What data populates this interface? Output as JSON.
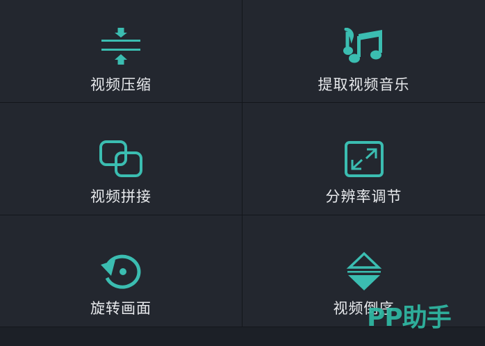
{
  "theme": {
    "accent": "#3bbdb1",
    "tile_background": "#23272f",
    "divider": "#13161b",
    "label_color": "#e8eaed"
  },
  "tools": [
    {
      "label": "视频压缩",
      "icon": "compress-icon"
    },
    {
      "label": "提取视频音乐",
      "icon": "music-note-icon"
    },
    {
      "label": "视频拼接",
      "icon": "overlap-squares-icon"
    },
    {
      "label": "分辨率调节",
      "icon": "expand-arrows-icon"
    },
    {
      "label": "旋转画面",
      "icon": "rotate-icon"
    },
    {
      "label": "视频倒序",
      "icon": "reverse-triangles-icon"
    }
  ],
  "watermark": {
    "text": "PP助手"
  }
}
